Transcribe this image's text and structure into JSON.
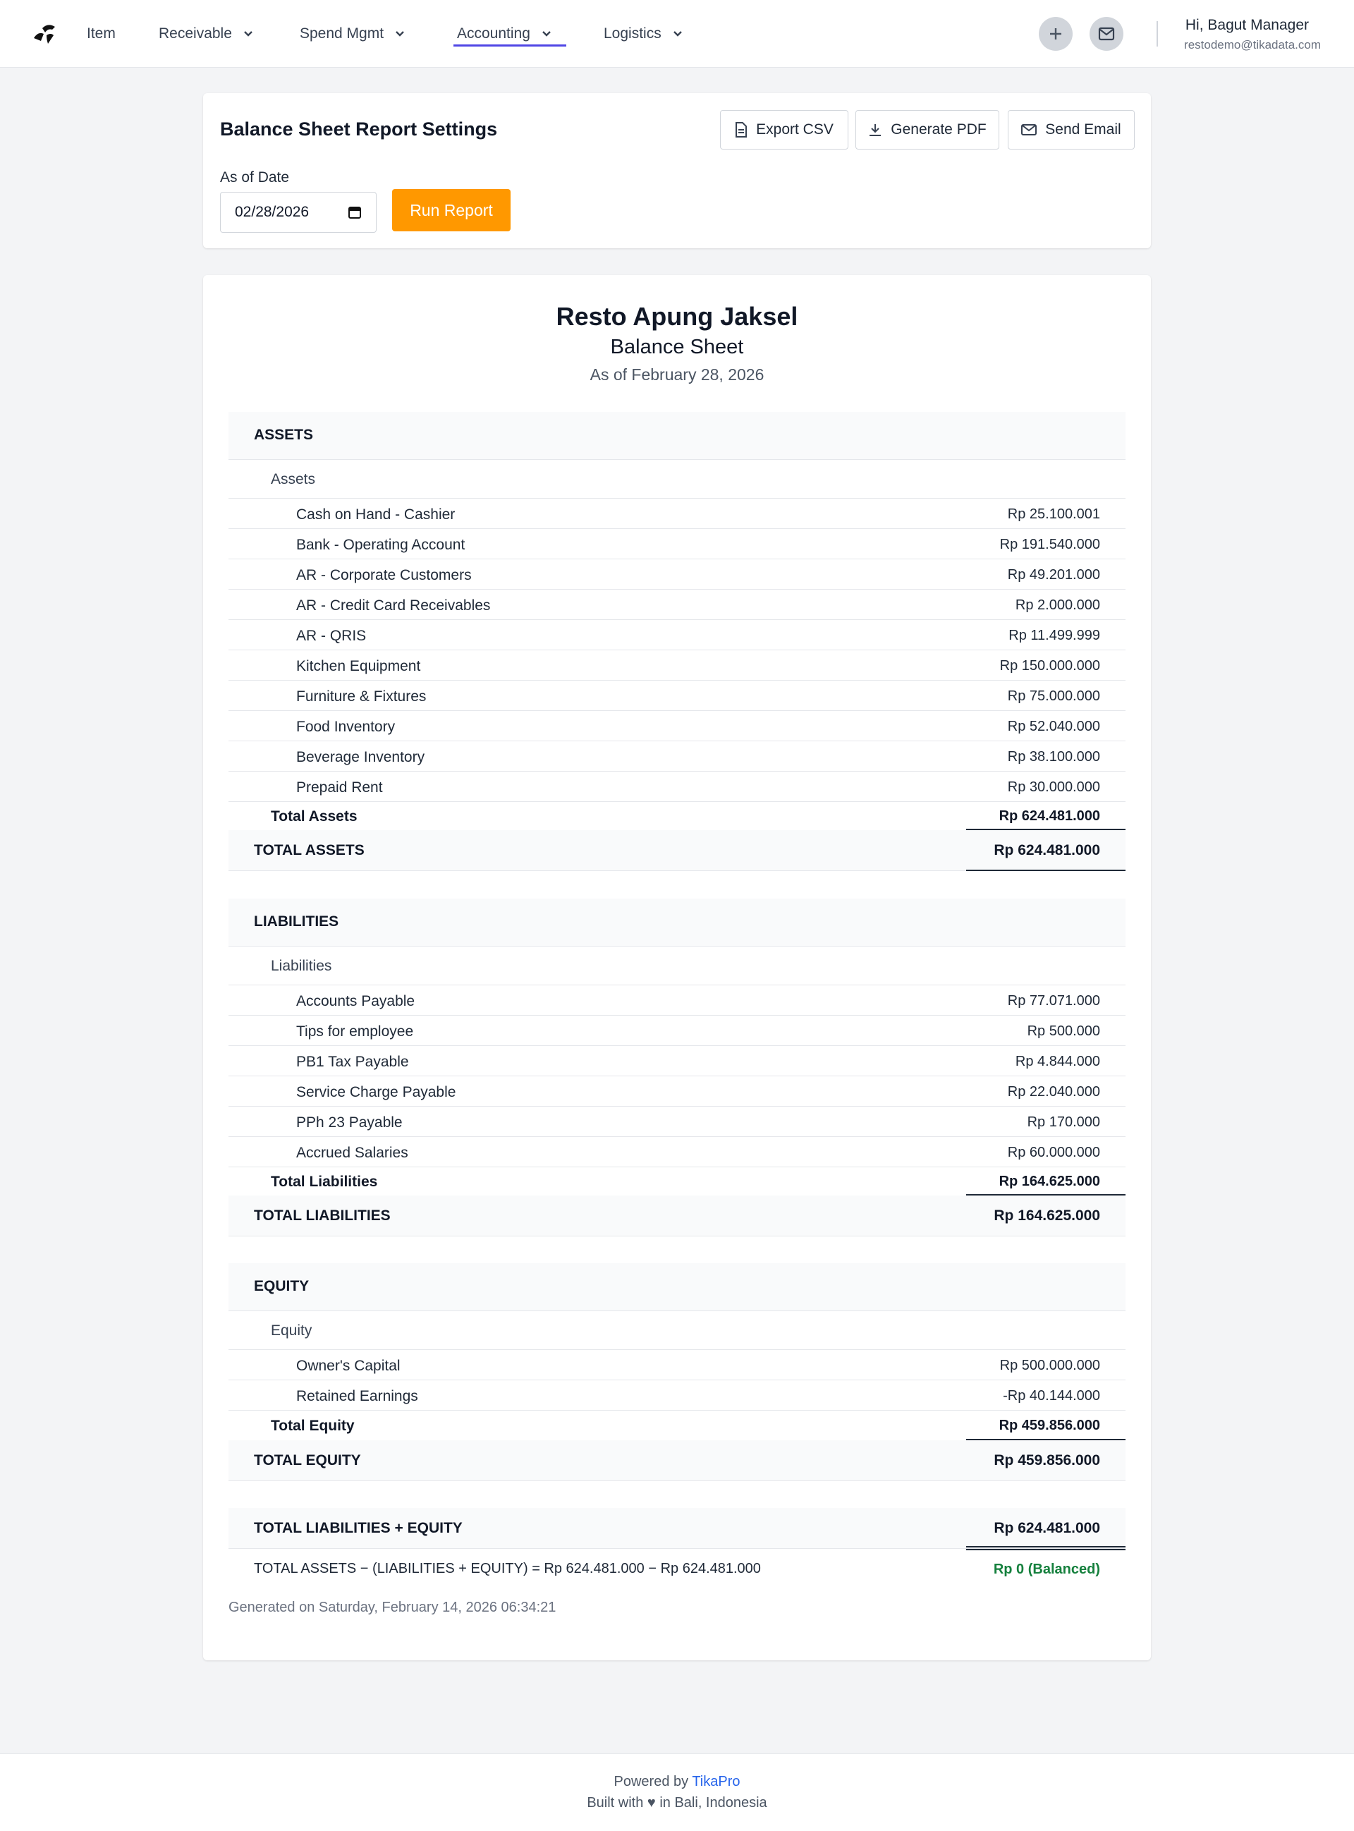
{
  "nav": {
    "items": [
      {
        "label": "Item"
      },
      {
        "label": "Receivable"
      },
      {
        "label": "Spend Mgmt"
      },
      {
        "label": "Accounting"
      },
      {
        "label": "Logistics"
      }
    ],
    "active": "Accounting",
    "user_greeting": "Hi, Bagut Manager",
    "user_email": "restodemo@tikadata.com",
    "icons": [
      "plus-icon",
      "mail-icon"
    ]
  },
  "settings": {
    "title": "Balance Sheet Report Settings",
    "export_csv": "Export CSV",
    "generate_pdf": "Generate PDF",
    "send_email": "Send Email",
    "date_label": "As of Date",
    "date_value": "02/28/2026",
    "run_label": "Run Report",
    "run_color": "#ff9800"
  },
  "report": {
    "company": "Resto Apung Jaksel",
    "title": "Balance Sheet",
    "as_of": "As of February 28, 2026",
    "assets": {
      "header": "ASSETS",
      "group": "Assets",
      "items": [
        {
          "name": "Cash on Hand - Cashier",
          "amount": "Rp 25.100.001"
        },
        {
          "name": "Bank - Operating Account",
          "amount": "Rp 191.540.000"
        },
        {
          "name": "AR - Corporate Customers",
          "amount": "Rp 49.201.000"
        },
        {
          "name": "AR - Credit Card Receivables",
          "amount": "Rp 2.000.000"
        },
        {
          "name": "AR - QRIS",
          "amount": "Rp 11.499.999"
        },
        {
          "name": "Kitchen Equipment",
          "amount": "Rp 150.000.000"
        },
        {
          "name": "Furniture & Fixtures",
          "amount": "Rp 75.000.000"
        },
        {
          "name": "Food Inventory",
          "amount": "Rp 52.040.000"
        },
        {
          "name": "Beverage Inventory",
          "amount": "Rp 38.100.000"
        },
        {
          "name": "Prepaid Rent",
          "amount": "Rp 30.000.000"
        }
      ],
      "subtotal_label": "Total Assets",
      "subtotal_amount": "Rp 624.481.000",
      "total_label": "TOTAL ASSETS",
      "total_amount": "Rp 624.481.000"
    },
    "liabilities": {
      "header": "LIABILITIES",
      "group": "Liabilities",
      "items": [
        {
          "name": "Accounts Payable",
          "amount": "Rp 77.071.000"
        },
        {
          "name": "Tips for employee",
          "amount": "Rp 500.000"
        },
        {
          "name": "PB1 Tax Payable",
          "amount": "Rp 4.844.000"
        },
        {
          "name": "Service Charge Payable",
          "amount": "Rp 22.040.000"
        },
        {
          "name": "PPh 23 Payable",
          "amount": "Rp 170.000"
        },
        {
          "name": "Accrued Salaries",
          "amount": "Rp 60.000.000"
        }
      ],
      "subtotal_label": "Total Liabilities",
      "subtotal_amount": "Rp 164.625.000",
      "total_label": "TOTAL LIABILITIES",
      "total_amount": "Rp 164.625.000"
    },
    "equity": {
      "header": "EQUITY",
      "group": "Equity",
      "items": [
        {
          "name": "Owner's Capital",
          "amount": "Rp 500.000.000"
        },
        {
          "name": "Retained Earnings",
          "amount": "-Rp 40.144.000"
        }
      ],
      "subtotal_label": "Total Equity",
      "subtotal_amount": "Rp 459.856.000",
      "total_label": "TOTAL EQUITY",
      "total_amount": "Rp 459.856.000"
    },
    "grand_total_label": "TOTAL LIABILITIES + EQUITY",
    "grand_total_amount": "Rp 624.481.000",
    "check_label": "TOTAL ASSETS − (LIABILITIES + EQUITY) = Rp 624.481.000 − Rp 624.481.000",
    "check_result": "Rp 0 (Balanced)",
    "check_color": "#15803d",
    "generated": "Generated on Saturday, February 14, 2026 06:34:21"
  },
  "footer": {
    "powered_prefix": "Powered by",
    "brand": "TikaPro",
    "built_prefix": "Built with",
    "built_suffix": "in Bali, Indonesia"
  }
}
